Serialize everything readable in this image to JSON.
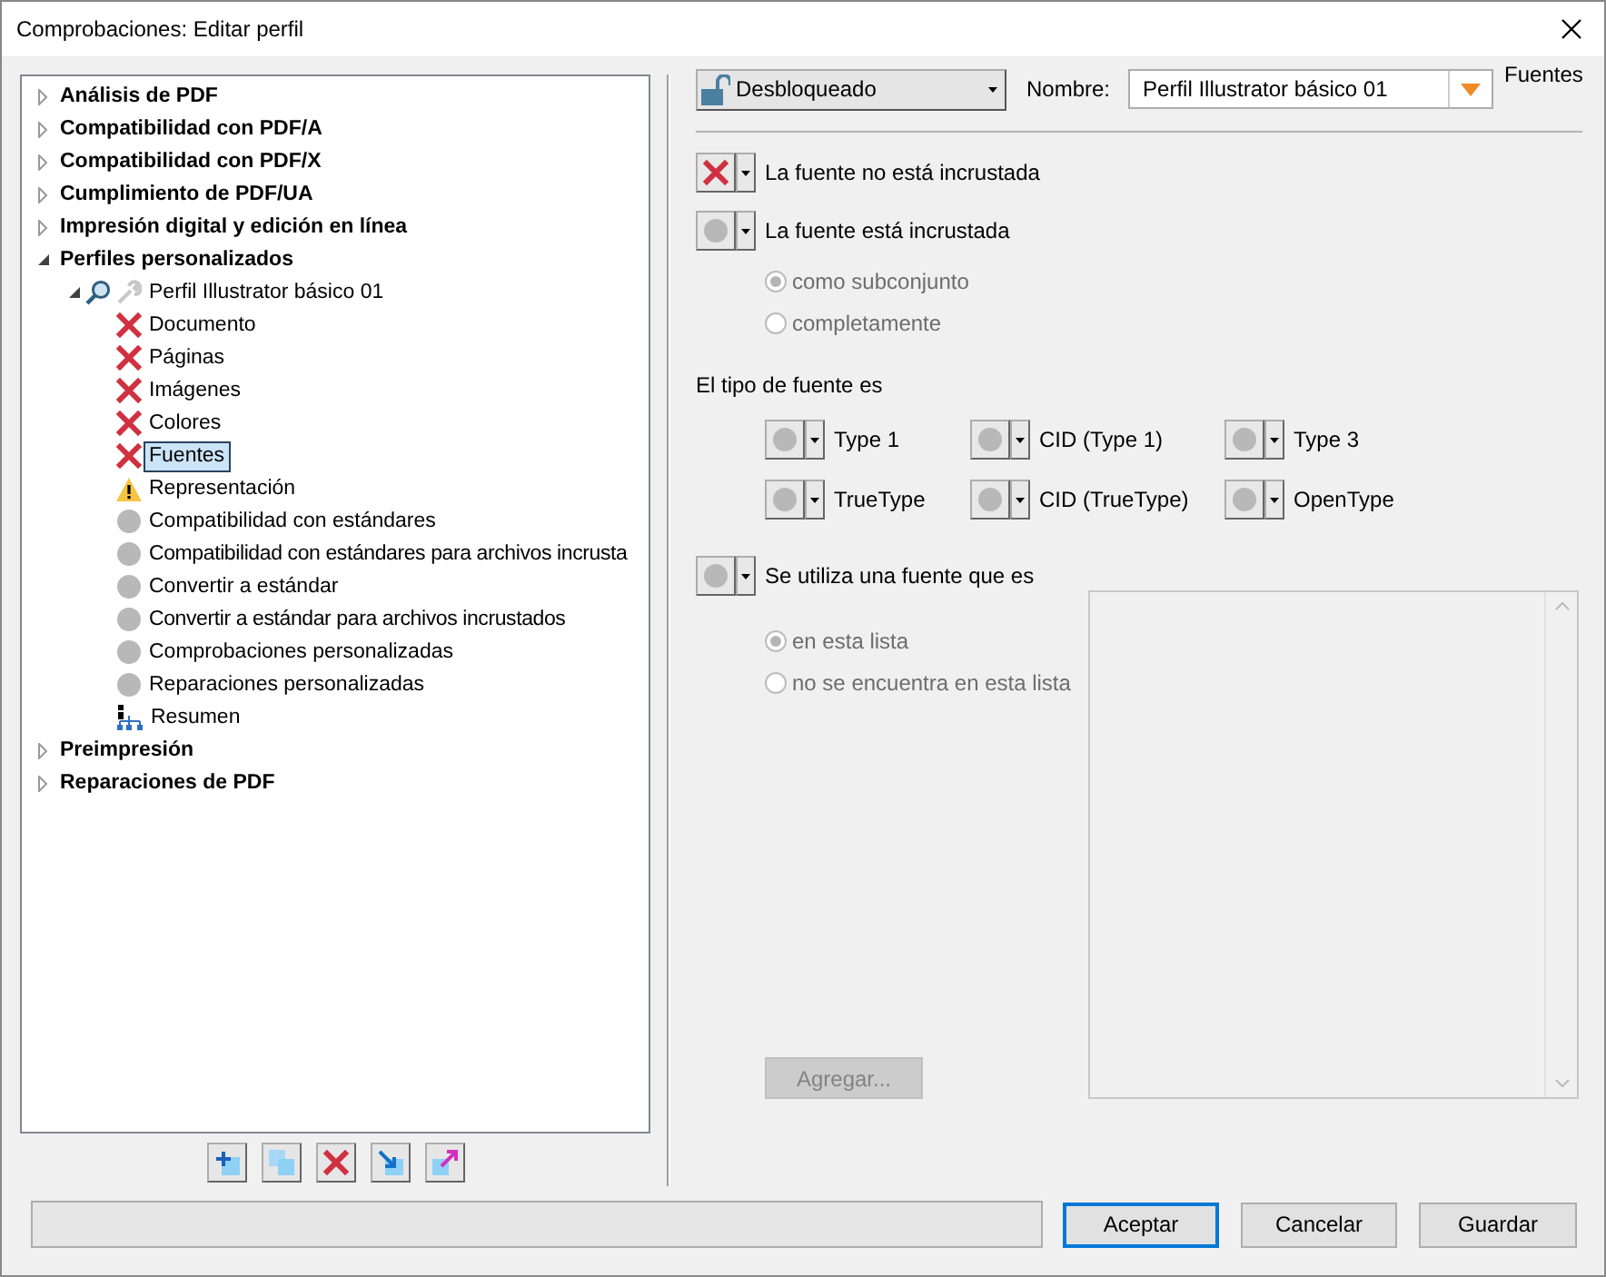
{
  "window": {
    "title": "Comprobaciones: Editar perfil"
  },
  "tree": [
    {
      "label": "Análisis de PDF",
      "expanded": false,
      "selected": false
    },
    {
      "label": "Compatibilidad con PDF/A",
      "expanded": false,
      "selected": false
    },
    {
      "label": "Compatibilidad con PDF/X",
      "expanded": false,
      "selected": false
    },
    {
      "label": "Cumplimiento de PDF/UA",
      "expanded": false,
      "selected": false
    },
    {
      "label": "Impresión digital y edición en línea",
      "expanded": false,
      "selected": false
    },
    {
      "label": "Perfiles personalizados",
      "expanded": true,
      "selected": false,
      "children": [
        {
          "label": "Perfil Illustrator básico 01",
          "kind": "profile",
          "expanded": true,
          "selected": false,
          "children": [
            {
              "label": "Documento",
              "kind": "error",
              "selected": false
            },
            {
              "label": "Páginas",
              "kind": "error",
              "selected": false
            },
            {
              "label": "Imágenes",
              "kind": "error",
              "selected": false
            },
            {
              "label": "Colores",
              "kind": "error",
              "selected": false
            },
            {
              "label": "Fuentes",
              "kind": "error",
              "selected": true
            },
            {
              "label": "Representación",
              "kind": "warning",
              "selected": false
            },
            {
              "label": "Compatibilidad con estándares",
              "kind": "none",
              "selected": false
            },
            {
              "label": "Compatibilidad con estándares para archivos incrusta",
              "kind": "none",
              "selected": false
            },
            {
              "label": "Convertir a estándar",
              "kind": "none",
              "selected": false
            },
            {
              "label": "Convertir a estándar para archivos incrustados",
              "kind": "none",
              "selected": false
            },
            {
              "label": "Comprobaciones personalizadas",
              "kind": "none",
              "selected": false
            },
            {
              "label": "Reparaciones personalizadas",
              "kind": "none",
              "selected": false
            },
            {
              "label": "Resumen",
              "kind": "summary",
              "selected": false
            }
          ]
        }
      ]
    },
    {
      "label": "Preimpresión",
      "expanded": false,
      "selected": false
    },
    {
      "label": "Reparaciones de PDF",
      "expanded": false,
      "selected": false
    }
  ],
  "tree_toolbar": [
    {
      "kind": "add"
    },
    {
      "kind": "duplicate"
    },
    {
      "kind": "delete"
    },
    {
      "kind": "import"
    },
    {
      "kind": "export"
    }
  ],
  "lock": {
    "label": "Desbloqueado"
  },
  "name_field": {
    "label": "Nombre:",
    "value": "Perfil Illustrator básico 01"
  },
  "section_title": "Fuentes",
  "embed_checks": [
    {
      "label": "La fuente no está incrustada",
      "kind": "error"
    },
    {
      "label": "La fuente está incrustada",
      "kind": "none"
    }
  ],
  "embed_options": [
    {
      "label": "como subconjunto",
      "selected": true,
      "disabled": true
    },
    {
      "label": "completamente",
      "selected": false,
      "disabled": true
    }
  ],
  "font_type_heading": "El tipo de fuente es",
  "font_types": [
    {
      "label": "Type 1",
      "kind": "none"
    },
    {
      "label": "CID (Type 1)",
      "kind": "none"
    },
    {
      "label": "Type 3",
      "kind": "none"
    },
    {
      "label": "TrueType",
      "kind": "none"
    },
    {
      "label": "CID (TrueType)",
      "kind": "none"
    },
    {
      "label": "OpenType",
      "kind": "none"
    }
  ],
  "list_check": {
    "label": "Se utiliza una fuente que es",
    "kind": "none"
  },
  "list_options": [
    {
      "label": "en esta lista",
      "selected": true,
      "disabled": true
    },
    {
      "label": "no se encuentra en esta lista",
      "selected": false,
      "disabled": true
    }
  ],
  "add_button": {
    "label": "Agregar...",
    "disabled": true
  },
  "buttons": [
    {
      "label": "Aceptar",
      "default": true
    },
    {
      "label": "Cancelar",
      "default": false
    },
    {
      "label": "Guardar",
      "default": false
    }
  ]
}
